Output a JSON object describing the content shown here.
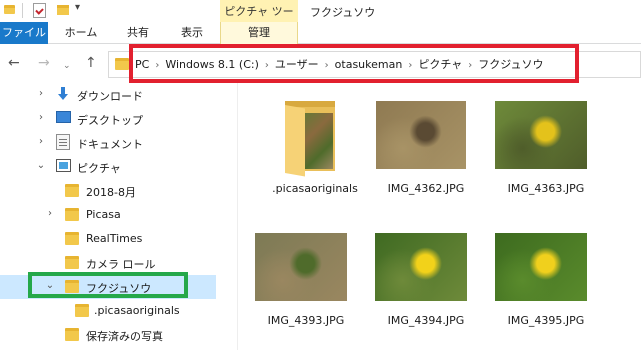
{
  "titlebar": {
    "tools_label": "ピクチャ ツール",
    "window_title": "フクジュソウ",
    "dropdown_glyph": "▾"
  },
  "ribbon": {
    "tabs": [
      {
        "label": "ファイル"
      },
      {
        "label": "ホーム"
      },
      {
        "label": "共有"
      },
      {
        "label": "表示"
      },
      {
        "label": "管理"
      }
    ],
    "file_color": "#1979ca",
    "tools_color": "#fff2b3"
  },
  "nav": {
    "back": "←",
    "forward": "→",
    "recent": "⌄",
    "up": "↑"
  },
  "address": {
    "separator": "›",
    "crumbs": [
      "PC",
      "Windows 8.1 (C:)",
      "ユーザー",
      "otasukeman",
      "ピクチャ",
      "フクジュソウ"
    ]
  },
  "tree": {
    "chevron_closed": "›",
    "chevron_open": "⌄",
    "items": [
      {
        "label": "ダウンロード",
        "icon": "download-icon"
      },
      {
        "label": "デスクトップ",
        "icon": "desktop-icon"
      },
      {
        "label": "ドキュメント",
        "icon": "documents-icon"
      },
      {
        "label": "ピクチャ",
        "icon": "pictures-icon"
      },
      {
        "label": "2018-8月",
        "icon": "folder-icon"
      },
      {
        "label": "Picasa",
        "icon": "folder-icon"
      },
      {
        "label": "RealTimes",
        "icon": "folder-icon"
      },
      {
        "label": "カメラ ロール",
        "icon": "folder-icon"
      },
      {
        "label": "フクジュソウ",
        "icon": "folder-icon"
      },
      {
        "label": ".picasaoriginals",
        "icon": "folder-icon"
      },
      {
        "label": "保存済みの写真",
        "icon": "folder-icon"
      }
    ]
  },
  "files": [
    {
      "name": ".picasaoriginals",
      "kind": "folder"
    },
    {
      "name": "IMG_4362.JPG",
      "kind": "image",
      "colors": [
        "#8f7a52",
        "#5a4a33",
        "#a89366"
      ]
    },
    {
      "name": "IMG_4363.JPG",
      "kind": "image",
      "colors": [
        "#6e8a3a",
        "#e4c21b",
        "#4f5d2a"
      ]
    },
    {
      "name": "IMG_4393.JPG",
      "kind": "image",
      "colors": [
        "#7d7a55",
        "#4f6b2b",
        "#9a8760"
      ]
    },
    {
      "name": "IMG_4394.JPG",
      "kind": "image",
      "colors": [
        "#3f6a22",
        "#f2d21a",
        "#6e8a3a"
      ]
    },
    {
      "name": "IMG_4395.JPG",
      "kind": "image",
      "colors": [
        "#3d6b1f",
        "#f0d01d",
        "#5a8b2c"
      ]
    }
  ],
  "highlights": {
    "address_box_color": "#e2202f",
    "selected_folder_box_color": "#25a84a",
    "selected_row_color": "#cce8ff"
  }
}
